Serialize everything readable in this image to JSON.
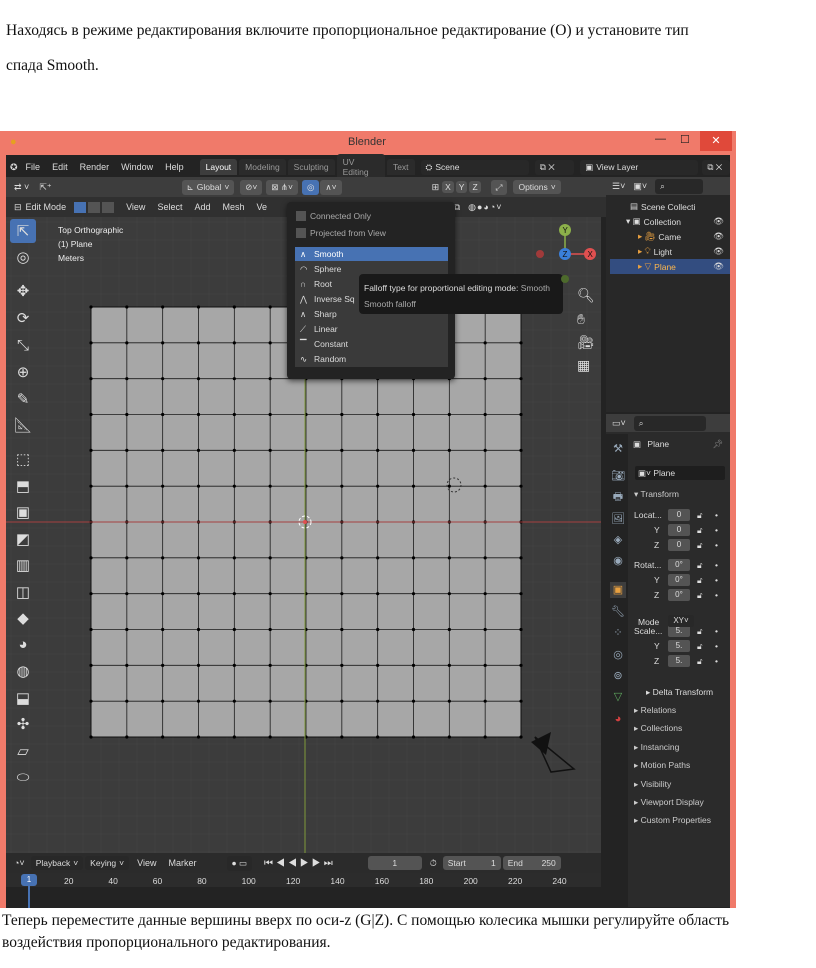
{
  "doc": {
    "intro": "Находясь в режиме редактирования включите пропорциональное редактирование (O) и установите тип",
    "intro2": "спада Smooth.",
    "outro": "Теперь переместите данные вершины вверх по оси-z (G|Z). С помощью колесика мышки регулируйте область",
    "outro2": "воздействия пропорционального редактирования."
  },
  "window": {
    "title": "Blender",
    "minimize": "—",
    "maximize": "☐",
    "close": "✕"
  },
  "menubar": {
    "items": [
      "File",
      "Edit",
      "Render",
      "Window",
      "Help"
    ],
    "tabs": [
      "Layout",
      "Modeling",
      "Sculpting",
      "UV Editing",
      "Text"
    ],
    "active_tab": "Layout",
    "scene": "Scene",
    "view_layer": "View Layer"
  },
  "toolbar": {
    "transform": "Global",
    "axes": [
      "X",
      "Y",
      "Z"
    ],
    "options": "Options"
  },
  "header": {
    "mode": "Edit Mode",
    "menus": [
      "View",
      "Select",
      "Add",
      "Mesh",
      "Ve"
    ]
  },
  "viewport": {
    "view": "Top Orthographic",
    "object": "(1) Plane",
    "units": "Meters"
  },
  "falloff_menu": {
    "connected": "Connected Only",
    "projected": "Projected from View",
    "items": [
      "Smooth",
      "Sphere",
      "Root",
      "Inverse Sq",
      "Sharp",
      "Linear",
      "Constant",
      "Random"
    ],
    "selected": "Smooth",
    "tooltip_title": "Falloff type for proportional editing mode:",
    "tooltip_value": "Smooth",
    "tooltip_sub": "Smooth falloff"
  },
  "outliner": {
    "root": "Scene Collecti",
    "collection": "Collection",
    "items": [
      "Came",
      "Light",
      "Plane"
    ]
  },
  "properties": {
    "object_name": "Plane",
    "data_name": "Plane",
    "transform": "Transform",
    "location_label": "Locat...",
    "rotation_label": "Rotat...",
    "scale_label": "Scale...",
    "location": [
      "0",
      "0",
      "0"
    ],
    "rotation": [
      "0°",
      "0°",
      "0°"
    ],
    "scale": [
      "5.",
      "5.",
      "5."
    ],
    "y_label": "Y",
    "z_label": "Z",
    "mode_label": "Mode",
    "mode_value": "XY",
    "delta": "Delta Transform",
    "sections": [
      "Relations",
      "Collections",
      "Instancing",
      "Motion Paths",
      "Visibility",
      "Viewport Display",
      "Custom Properties"
    ]
  },
  "timeline": {
    "playback": "Playback",
    "keying": "Keying",
    "view": "View",
    "marker": "Marker",
    "frame": "1",
    "start_label": "Start",
    "start": "1",
    "end_label": "End",
    "end": "250",
    "current": "1",
    "ticks": [
      "20",
      "40",
      "60",
      "80",
      "100",
      "120",
      "140",
      "160",
      "180",
      "200",
      "220",
      "240"
    ]
  }
}
